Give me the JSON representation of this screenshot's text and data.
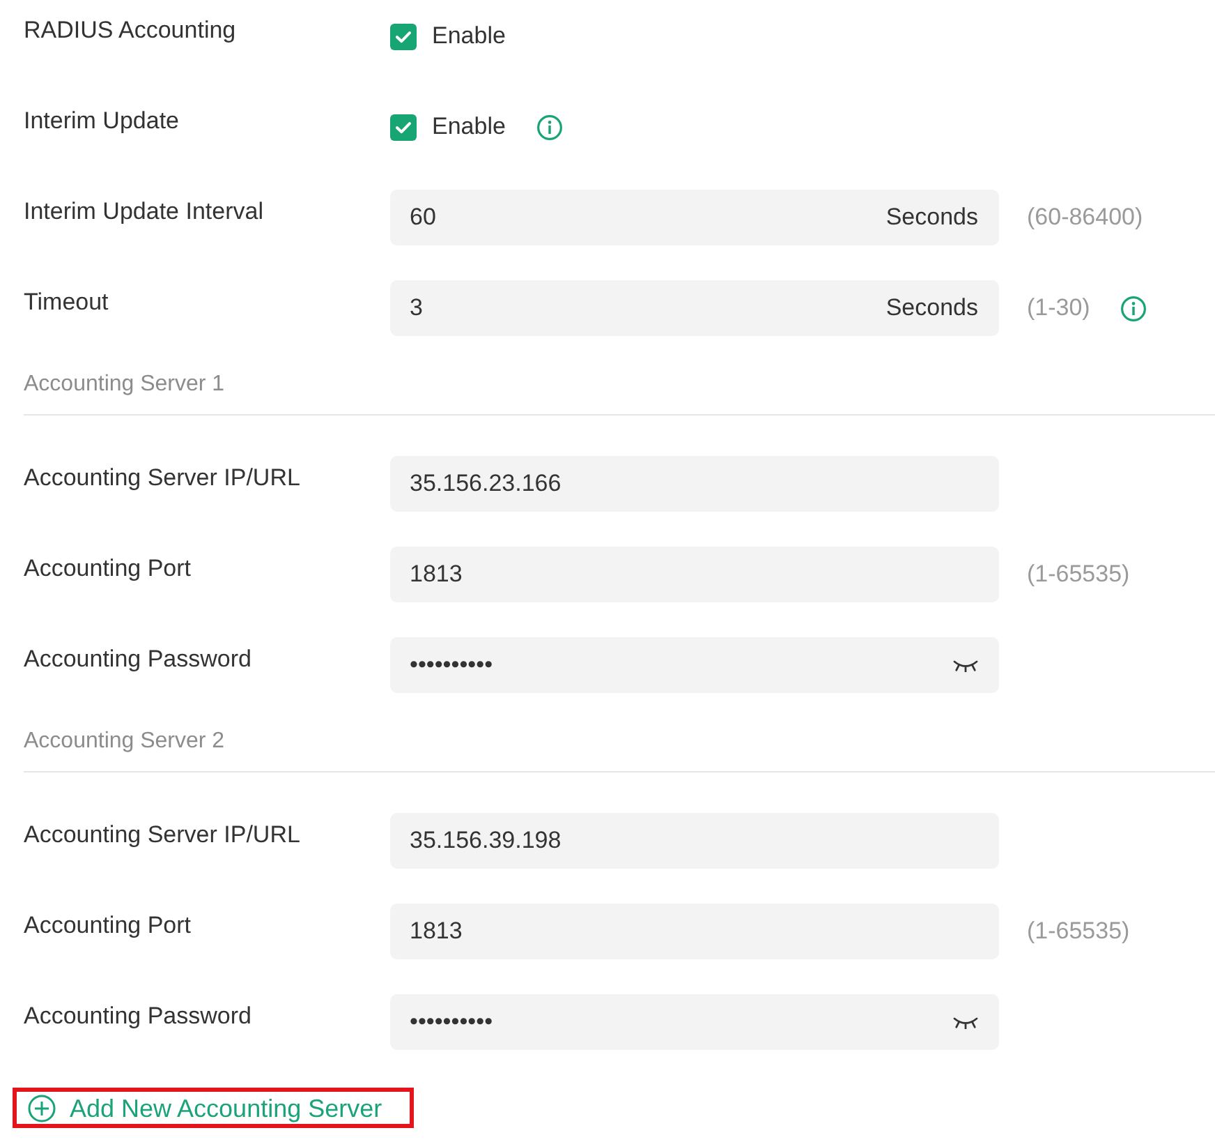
{
  "settings": [
    {
      "kind": "checkbox",
      "label": "RADIUS Accounting",
      "checked": true,
      "option": "Enable",
      "info": false
    },
    {
      "kind": "checkbox",
      "label": "Interim Update",
      "checked": true,
      "option": "Enable",
      "info": true
    },
    {
      "kind": "number",
      "label": "Interim Update Interval",
      "value": "60",
      "unit": "Seconds",
      "hint": "(60-86400)",
      "info": false
    },
    {
      "kind": "number",
      "label": "Timeout",
      "value": "3",
      "unit": "Seconds",
      "hint": "(1-30)",
      "info": true
    }
  ],
  "servers": [
    {
      "title": "Accounting Server 1",
      "fields": [
        {
          "kind": "text",
          "label": "Accounting Server IP/URL",
          "value": "35.156.23.166"
        },
        {
          "kind": "text",
          "label": "Accounting Port",
          "value": "1813",
          "hint": "(1-65535)"
        },
        {
          "kind": "password",
          "label": "Accounting Password",
          "value": "••••••••••"
        }
      ]
    },
    {
      "title": "Accounting Server 2",
      "fields": [
        {
          "kind": "text",
          "label": "Accounting Server IP/URL",
          "value": "35.156.39.198"
        },
        {
          "kind": "text",
          "label": "Accounting Port",
          "value": "1813",
          "hint": "(1-65535)"
        },
        {
          "kind": "password",
          "label": "Accounting Password",
          "value": "••••••••••"
        }
      ]
    }
  ],
  "add_button": {
    "label": "Add New Accounting Server",
    "highlighted": true
  }
}
